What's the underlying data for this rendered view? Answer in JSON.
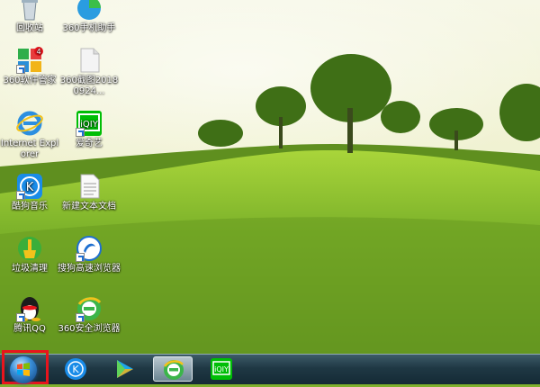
{
  "desktop": {
    "icons": [
      {
        "name": "recycle-bin",
        "label": "回收站"
      },
      {
        "name": "360-mobile-assistant",
        "label": "360手机助手"
      },
      {
        "name": "360-software-manager",
        "label": "360软件管家",
        "badge": "4"
      },
      {
        "name": "360-screenshot-file",
        "label": "360截图20180924..."
      },
      {
        "name": "internet-explorer",
        "label": "Internet Explorer"
      },
      {
        "name": "iqiyi",
        "label": "爱奇艺"
      },
      {
        "name": "kugou-music",
        "label": "酷狗音乐"
      },
      {
        "name": "new-text-document",
        "label": "新建文本文档"
      },
      {
        "name": "junk-cleanup",
        "label": "垃圾清理"
      },
      {
        "name": "sogou-browser",
        "label": "搜狗高速浏览器"
      },
      {
        "name": "tencent-qq",
        "label": "腾讯QQ"
      },
      {
        "name": "360-safe-browser",
        "label": "360安全浏览器"
      }
    ]
  },
  "taskbar": {
    "start_icon": "windows-start-orb",
    "pinned": [
      {
        "name": "kugou-music",
        "icon": "k-letter-icon"
      },
      {
        "name": "media-player",
        "icon": "play-icon"
      },
      {
        "name": "360-safe-browser",
        "icon": "e-browser-icon",
        "active": true
      },
      {
        "name": "iqiyi",
        "icon": "iqiyi-icon"
      }
    ],
    "highlight_color": "#e8141c"
  }
}
